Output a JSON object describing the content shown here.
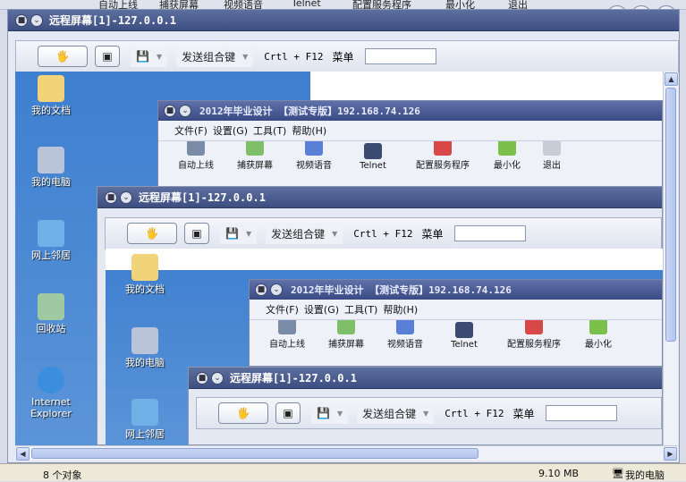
{
  "background": {
    "items": [
      "自动上线",
      "捕获屏幕",
      "视频语音",
      "Telnet",
      "配置服务程序",
      "最小化",
      "退出"
    ]
  },
  "remote": {
    "title": "远程屏幕[1]-127.0.0.1",
    "send_combo": "发送组合键",
    "shortcut": "Crtl + F12",
    "menu": "菜单"
  },
  "app": {
    "title": "2012年毕业设计  【测试专版】192.168.74.126",
    "menus": [
      "文件(F)",
      "设置(G)",
      "工具(T)",
      "帮助(H)"
    ],
    "toolbar": [
      "自动上线",
      "捕获屏幕",
      "视频语音",
      "Telnet",
      "配置服务程序",
      "最小化",
      "退出"
    ]
  },
  "desktop": {
    "icons": [
      "我的文档",
      "我的电脑",
      "网上邻居",
      "回收站",
      "Internet Explorer"
    ]
  },
  "status": {
    "objects": "8 个对象",
    "size": "9.10 MB",
    "location": "我的电脑"
  },
  "colors": {
    "title_bar": "#3d4f80",
    "desktop": "#3e74c0"
  }
}
